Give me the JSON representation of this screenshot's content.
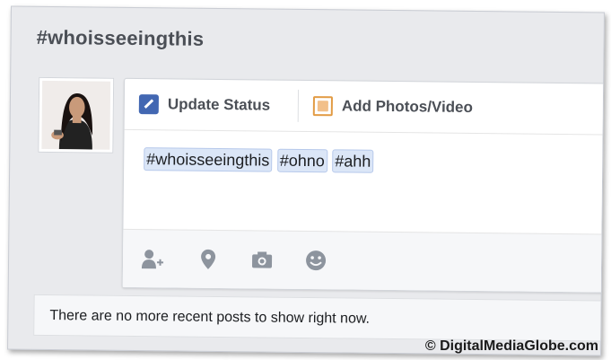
{
  "header": {
    "title": "#whoisseeingthis"
  },
  "composer": {
    "tabs": [
      {
        "label": "Update Status",
        "icon": "pencil-icon"
      },
      {
        "label": "Add Photos/Video",
        "icon": "photo-icon"
      }
    ],
    "hashtags": [
      "#whoisseeingthis",
      "#ohno",
      "#ahh"
    ],
    "toolbar": [
      {
        "icon": "tag-friends-icon"
      },
      {
        "icon": "location-pin-icon"
      },
      {
        "icon": "camera-icon"
      },
      {
        "icon": "smiley-icon"
      }
    ]
  },
  "footer": {
    "message": "There are no more recent posts to show right now."
  },
  "watermark": "© DigitalMediaGlobe.com",
  "colors": {
    "accent": "#4267b2",
    "hashtag_bg": "#dbe6f7",
    "frame_bg": "#e9eaed"
  }
}
